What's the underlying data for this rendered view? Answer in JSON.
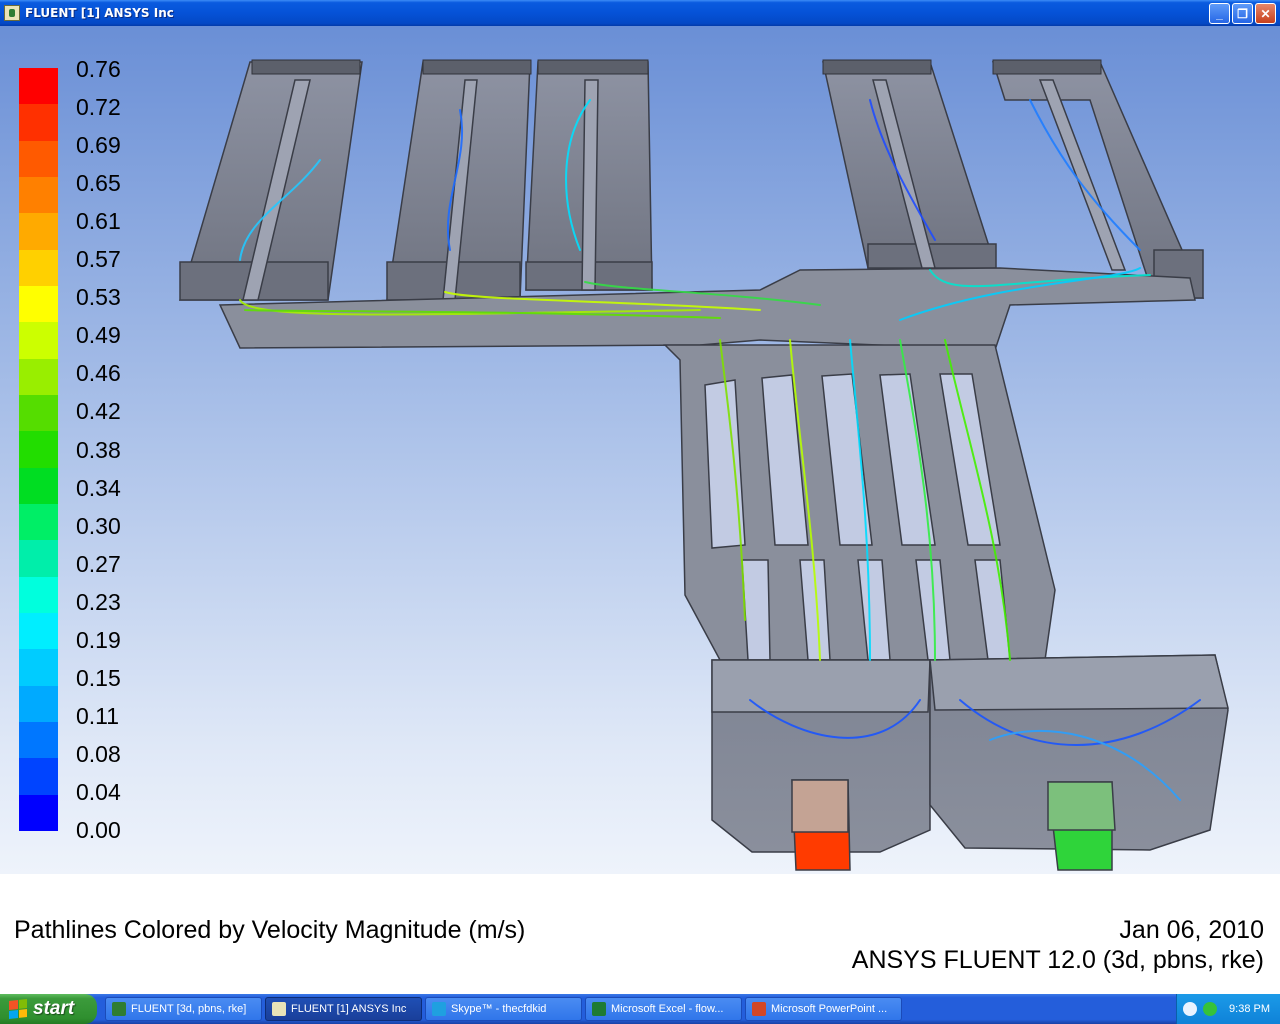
{
  "window": {
    "title": "FLUENT [1] ANSYS Inc",
    "minimize_glyph": "_",
    "restore_glyph": "❐",
    "close_glyph": "✕"
  },
  "legend": {
    "labels": [
      "0.76",
      "0.72",
      "0.69",
      "0.65",
      "0.61",
      "0.57",
      "0.53",
      "0.49",
      "0.46",
      "0.42",
      "0.38",
      "0.34",
      "0.30",
      "0.27",
      "0.23",
      "0.19",
      "0.15",
      "0.11",
      "0.08",
      "0.04",
      "0.00"
    ],
    "colors": [
      "#ff0000",
      "#ff3000",
      "#ff5a00",
      "#ff8000",
      "#ffaa00",
      "#ffd000",
      "#ffff00",
      "#ccff00",
      "#99ee00",
      "#55dd00",
      "#22dd00",
      "#00dd22",
      "#00ee66",
      "#00eeaa",
      "#00ffdd",
      "#00eeff",
      "#00ccff",
      "#00aaff",
      "#0077ff",
      "#0044ff",
      "#0000ff"
    ]
  },
  "viewport": {
    "caption": "Pathlines Colored by Velocity Magnitude (m/s)",
    "date": "Jan 06, 2010",
    "product": "ANSYS FLUENT 12.0 (3d, pbns, rke)"
  },
  "taskbar": {
    "start_label": "start",
    "tasks": [
      {
        "label": "FLUENT  [3d, pbns, rke]",
        "icon_color": "#2f7d32",
        "active": false
      },
      {
        "label": "FLUENT [1] ANSYS Inc",
        "icon_color": "#e9e4b8",
        "active": true
      },
      {
        "label": "Skype™ - thecfdkid",
        "icon_color": "#1fa0e0",
        "active": false
      },
      {
        "label": "Microsoft Excel - flow...",
        "icon_color": "#1e7b34",
        "active": false
      },
      {
        "label": "Microsoft PowerPoint ...",
        "icon_color": "#d24726",
        "active": false
      }
    ],
    "clock": "9:38 PM"
  }
}
